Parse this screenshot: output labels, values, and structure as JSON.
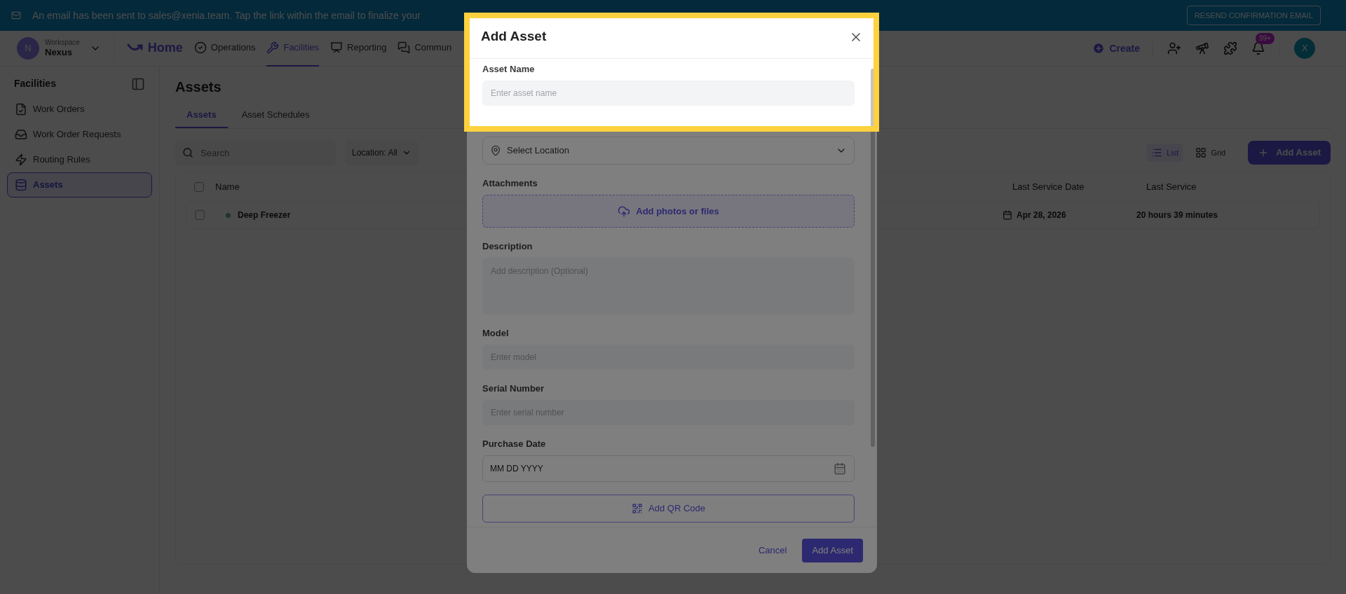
{
  "banner": {
    "message": "An email has been sent to sales@xenia.team. Tap the link within the email to finalize your",
    "button": "RESEND CONFIRMATION EMAIL"
  },
  "workspace": {
    "initial": "N",
    "label": "Workspace",
    "name": "Nexus"
  },
  "nav": [
    {
      "kind": "home",
      "label": "Home",
      "selected": false
    },
    {
      "kind": "operations",
      "label": "Operations",
      "selected": false
    },
    {
      "kind": "facilities",
      "label": "Facilities",
      "selected": true
    },
    {
      "kind": "reporting",
      "label": "Reporting",
      "selected": false
    },
    {
      "kind": "chat",
      "label": "Commun",
      "selected": false
    }
  ],
  "header_actions": {
    "create": "Create",
    "notifications": "99+",
    "avatar": "X"
  },
  "sidebar": {
    "title": "Facilities",
    "items": [
      {
        "kind": "orders",
        "label": "Work Orders",
        "selected": false
      },
      {
        "kind": "requests",
        "label": "Work Order Requests",
        "selected": false
      },
      {
        "kind": "rules",
        "label": "Routing Rules",
        "selected": false
      },
      {
        "kind": "assets",
        "label": "Assets",
        "selected": true
      }
    ]
  },
  "page": {
    "title": "Assets",
    "tabs": [
      {
        "label": "Assets",
        "selected": true
      },
      {
        "label": "Asset Schedules",
        "selected": false
      }
    ],
    "search": {
      "placeholder": "Search"
    },
    "location_filter": "Location: All",
    "views": [
      {
        "kind": "list",
        "label": "List",
        "selected": true
      },
      {
        "kind": "grid",
        "label": "Grid",
        "selected": false
      }
    ],
    "add_button": "Add Asset"
  },
  "table": {
    "columns": [
      "Name",
      "Last Service Date",
      "Last Service"
    ],
    "all_checked": false,
    "rows": [
      {
        "checked": false,
        "name": "Deep Freezer",
        "last_service_date": "Apr 28, 2026",
        "last_service": "20 hours 39 minutes"
      }
    ]
  },
  "modal": {
    "title": "Add Asset",
    "fields": [
      {
        "kind": "text",
        "label": "Asset Name",
        "placeholder": "Enter asset name"
      },
      {
        "kind": "select",
        "placeholder": "Select Location"
      },
      {
        "kind": "upload",
        "label": "Attachments",
        "text": "Add photos or files"
      },
      {
        "kind": "textarea",
        "label": "Description",
        "placeholder": "Add description (Optional)"
      },
      {
        "kind": "text",
        "label": "Model",
        "placeholder": "Enter model"
      },
      {
        "kind": "text",
        "label": "Serial Number",
        "placeholder": "Enter serial number"
      },
      {
        "kind": "date",
        "label": "Purchase Date",
        "placeholder": "MM DD YYYY"
      },
      {
        "kind": "qr",
        "text": "Add QR Code"
      }
    ],
    "cancel": "Cancel",
    "submit": "Add Asset"
  }
}
